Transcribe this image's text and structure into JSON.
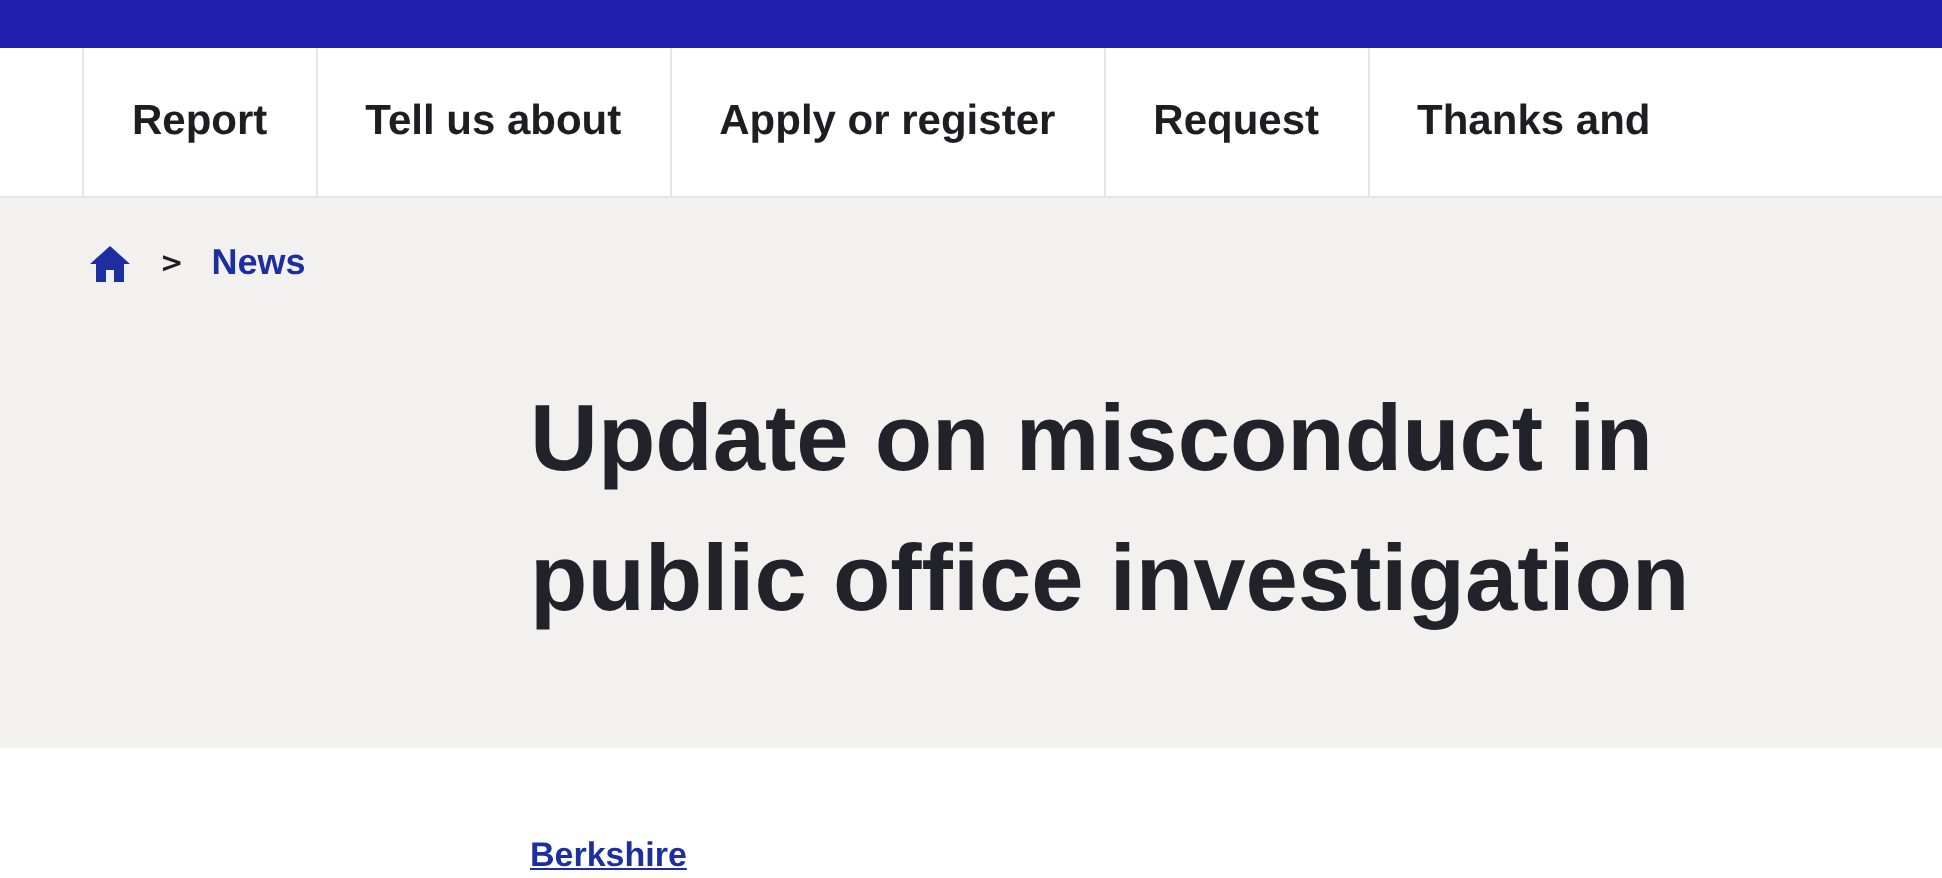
{
  "nav": {
    "items": [
      {
        "label": "Report"
      },
      {
        "label": "Tell us about"
      },
      {
        "label": "Apply or register"
      },
      {
        "label": "Request"
      },
      {
        "label": "Thanks and"
      }
    ]
  },
  "breadcrumb": {
    "separator": ">",
    "items": [
      {
        "label": "News"
      }
    ]
  },
  "heading": "Update on misconduct in public office investigation",
  "tag_link": "Berkshire"
}
